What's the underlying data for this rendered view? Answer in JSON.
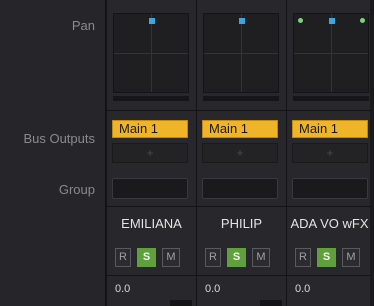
{
  "row_labels": {
    "pan": "Pan",
    "bus_outputs": "Bus Outputs",
    "group": "Group"
  },
  "channels": [
    {
      "name": "EMILIANA",
      "bus_output": "Main 1",
      "bus_add": "+",
      "rsm": {
        "r": "R",
        "s": "S",
        "m": "M"
      },
      "level": "0.0"
    },
    {
      "name": "PHILIP",
      "bus_output": "Main 1",
      "bus_add": "+",
      "rsm": {
        "r": "R",
        "s": "S",
        "m": "M"
      },
      "level": "0.0"
    },
    {
      "name": "ADA VO wFX",
      "bus_output": "Main 1",
      "bus_add": "+",
      "rsm": {
        "r": "R",
        "s": "S",
        "m": "M"
      },
      "level": "0.0"
    }
  ],
  "colors": {
    "bus_output": "#f0b428",
    "solo_active": "#5fa03c",
    "pan_mono": "#3aa8e0",
    "pan_stereo_edge": "#7ed07a"
  }
}
